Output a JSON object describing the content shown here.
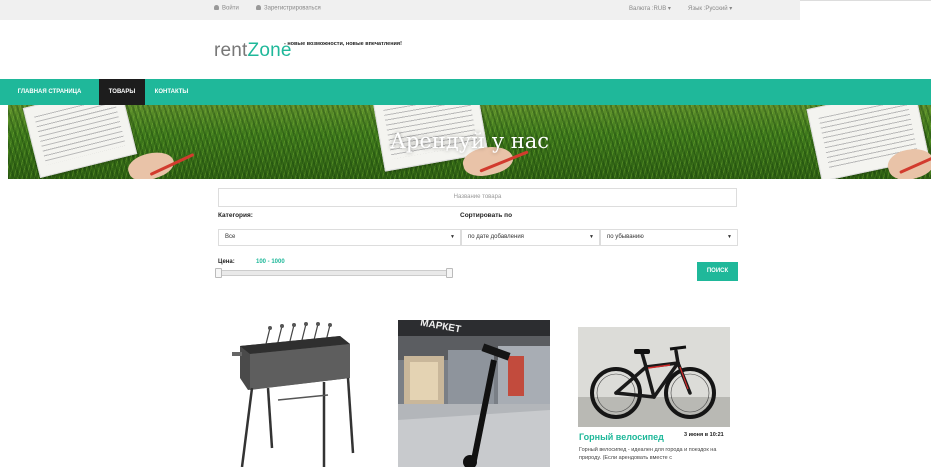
{
  "topbar": {
    "login": "Войти",
    "register": "Зарегистрироваться",
    "currency": "Валюта :RUB ▾",
    "language": "Язык :Русский ▾",
    "icons": [
      "user-icon",
      "user-icon"
    ]
  },
  "brand": {
    "logo_part1": "rent",
    "logo_part2": "Zone",
    "tagline": "- новые возможности, новые впечатления!",
    "accent_color": "#1fb89a"
  },
  "nav": {
    "items": [
      {
        "label": "ГЛАВНАЯ СТРАНИЦА",
        "active": false
      },
      {
        "label": "ТОВАРЫ",
        "active": true
      },
      {
        "label": "КОНТАКТЫ",
        "active": false
      }
    ]
  },
  "banner": {
    "title": "Арендуй у нас"
  },
  "search": {
    "placeholder": "Название товара",
    "category_label": "Категория:",
    "category_value": "Все",
    "sort_label": "Сортировать по",
    "sort_field_value": "по дате добавления",
    "sort_order_value": "по убыванию",
    "price_label": "Цена:",
    "price_range": "100 - 1000",
    "button_label": "ПОИСК"
  },
  "products": [
    {
      "image": "grill-image"
    },
    {
      "image": "scooter-image",
      "sign_text": "МАРКЕТ"
    },
    {
      "image": "bicycle-image",
      "title": "Горный велосипед",
      "date": "3 июня в 10:21",
      "description": "Горный велосипед - идеален для города и поездок на природу. (Если арендовать вместе с"
    }
  ]
}
